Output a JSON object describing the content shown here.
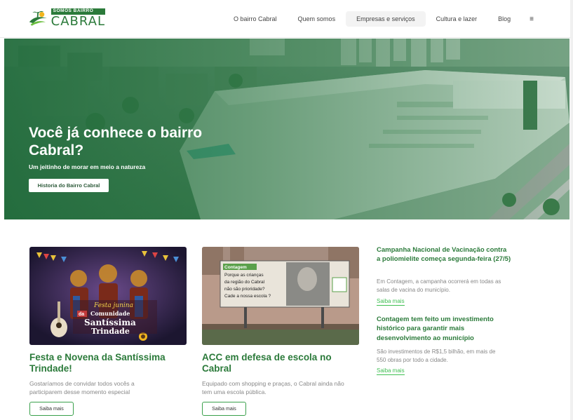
{
  "header": {
    "logo_top": "SOMOS BAIRRO",
    "logo_main": "CABRAL",
    "nav": [
      {
        "label": "O bairro Cabral"
      },
      {
        "label": "Quem somos"
      },
      {
        "label": "Empresas e serviços"
      },
      {
        "label": "Cultura e lazer"
      },
      {
        "label": "Blog"
      }
    ],
    "menu_icon": "≡"
  },
  "hero": {
    "title": "Você já conhece o bairro Cabral?",
    "subtitle": "Um jeitinho de morar em meio a natureza",
    "button": "Historia do Bairro Cabral"
  },
  "cards": [
    {
      "image_text_1": "Festa junina",
      "image_text_2": "da",
      "image_text_3": "Comunidade",
      "image_text_4": "Santíssima",
      "image_text_5": "Trindade",
      "title": "Festa e Novena da Santíssima Trindade!",
      "text": "Gostaríamos de convidar todos vocês a participarem desse momento especial",
      "button": "Saiba mais"
    },
    {
      "billboard_tag": "Contagem",
      "billboard_lines": [
        "Porque as crianças",
        "da região do Cabral",
        "não são prioridade?",
        "Cade a nossa escola ?"
      ],
      "title": "ACC em defesa de escola no Cabral",
      "text": "Equipado com shopping e praças, o Cabral ainda não tem uma escola pública.",
      "button": "Saiba mais"
    }
  ],
  "news": [
    {
      "title": "Campanha Nacional de Vacinação contra a poliomielite começa segunda-feira (27/5)",
      "text": "Em Contagem, a campanha ocorrerá em todas as salas de vacina do município.",
      "link": "Saiba mais"
    },
    {
      "title": "Contagem tem feito um investimento histórico para garantir mais desenvolvimento ao município",
      "text": "São investimentos de R$1,5 bilhão, em mais de 550 obras por todo a cidade.",
      "link": "Saiba mais"
    }
  ],
  "colors": {
    "brand_green": "#2b7a3a",
    "link_green": "#3fbf52",
    "hero_overlay": "#2f6e45"
  }
}
